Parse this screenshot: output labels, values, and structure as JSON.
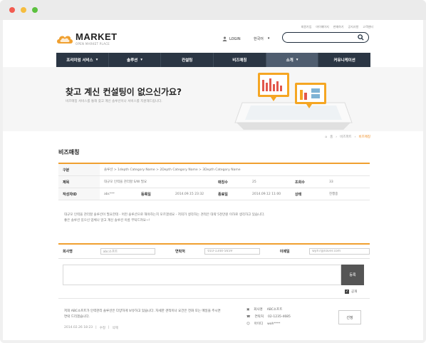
{
  "top_links": [
    "회원가입",
    "마이페이지",
    "판매하기",
    "공지사항",
    "고객센터"
  ],
  "brand": {
    "name": "MARKET",
    "tagline": "OPEN MARKET PLACE",
    "accent": "#f0a030"
  },
  "header": {
    "login_label": "LOGIN",
    "lang_label": "한국어",
    "search_placeholder": ""
  },
  "nav": [
    "프리미엄 서비스",
    "솔루션",
    "컨설팅",
    "비즈매칭",
    "소개",
    "커뮤니케이션"
  ],
  "banner": {
    "title": "찾고 계신 컨설팅이 없으신가요?",
    "subtitle": "비즈매칭 서비스를 통해 찾고 계신 솔루션이나 서비스를 지원해드립니다."
  },
  "breadcrumb": {
    "home": "홈",
    "parent": "비즈파트",
    "current": "비즈매칭"
  },
  "page_title": "비즈매칭",
  "info": {
    "category_label": "구분",
    "category_value": "솔루션  >  1depth Category Name  >  2Depth Category Name  >  3Depth Category Name",
    "subject_label": "제목",
    "subject_value": "대규모 인력을 관리할 S/W 필요",
    "match_label": "매칭수",
    "match_value": "25",
    "views_label": "조회수",
    "views_value": "33",
    "author_label": "작성자ID",
    "author_value": "abc***",
    "reg_label": "등록일",
    "reg_value": "2014.09.15 23:32",
    "end_label": "종료일",
    "end_value": "2014.09.12 11:00",
    "status_label": "상태",
    "status_value": "진행중"
  },
  "body": [
    "대규모 인력을 관리할 솔루션이 필요한데 - 어떤 솔루션으로 해야하는지 모르겠네요 - 저희가 생각하는 견적은 대략 5천만원 이하로 생각하고 있습니다.",
    "좋은 솔루션 있으신 업체나 알고 계신 솔루션 이름 부탁드려요~!"
  ],
  "contact": {
    "company_label": "회사명",
    "company_value": "abc소프트",
    "phone_label": "연락처",
    "phone_value": "010-1344-5659",
    "email_label": "이메일",
    "email_value": "wyh7@naver.com"
  },
  "comment": {
    "submit_label": "등록",
    "public_label": "공개"
  },
  "reply": {
    "text": "저희 ABC소프트가 인력관리 솔루션은 다양하게 보유하고 있습니다. 자세한 견적이나 요건은 전화 또는 메일을 주시면 연락 드리겠습니다.",
    "date": "2014.02.26 18:23",
    "edit": "수정",
    "delete": "삭제",
    "company_label": "회사명",
    "company_value": "ABC소프트",
    "phone_label": "연락처",
    "phone_value": "02-1235-4685",
    "id_label": "아이디",
    "id_value": "woh****",
    "select_label": "선정"
  }
}
